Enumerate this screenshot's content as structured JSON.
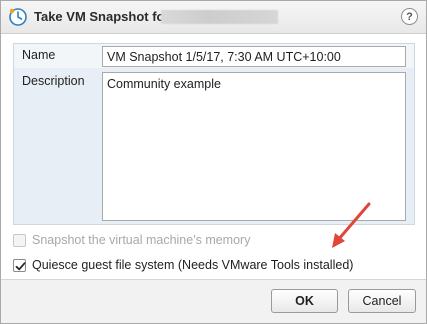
{
  "dialog": {
    "title": "Take VM Snapshot for",
    "title_icon": "vm-snapshot-clock-icon",
    "help_label": "?"
  },
  "form": {
    "name_label": "Name",
    "name_value": "VM Snapshot 1/5/17, 7:30 AM UTC+10:00",
    "description_label": "Description",
    "description_value": "Community example"
  },
  "options": {
    "memory_label": "Snapshot the virtual machine's memory",
    "memory_checked": false,
    "memory_enabled": false,
    "quiesce_label": "Quiesce guest file system (Needs VMware Tools installed)",
    "quiesce_checked": true
  },
  "footer": {
    "ok_label": "OK",
    "cancel_label": "Cancel"
  },
  "colors": {
    "panel_bg": "#e7eef5",
    "annotation_arrow": "#e0463a",
    "icon_accent": "#2f7fc1"
  }
}
